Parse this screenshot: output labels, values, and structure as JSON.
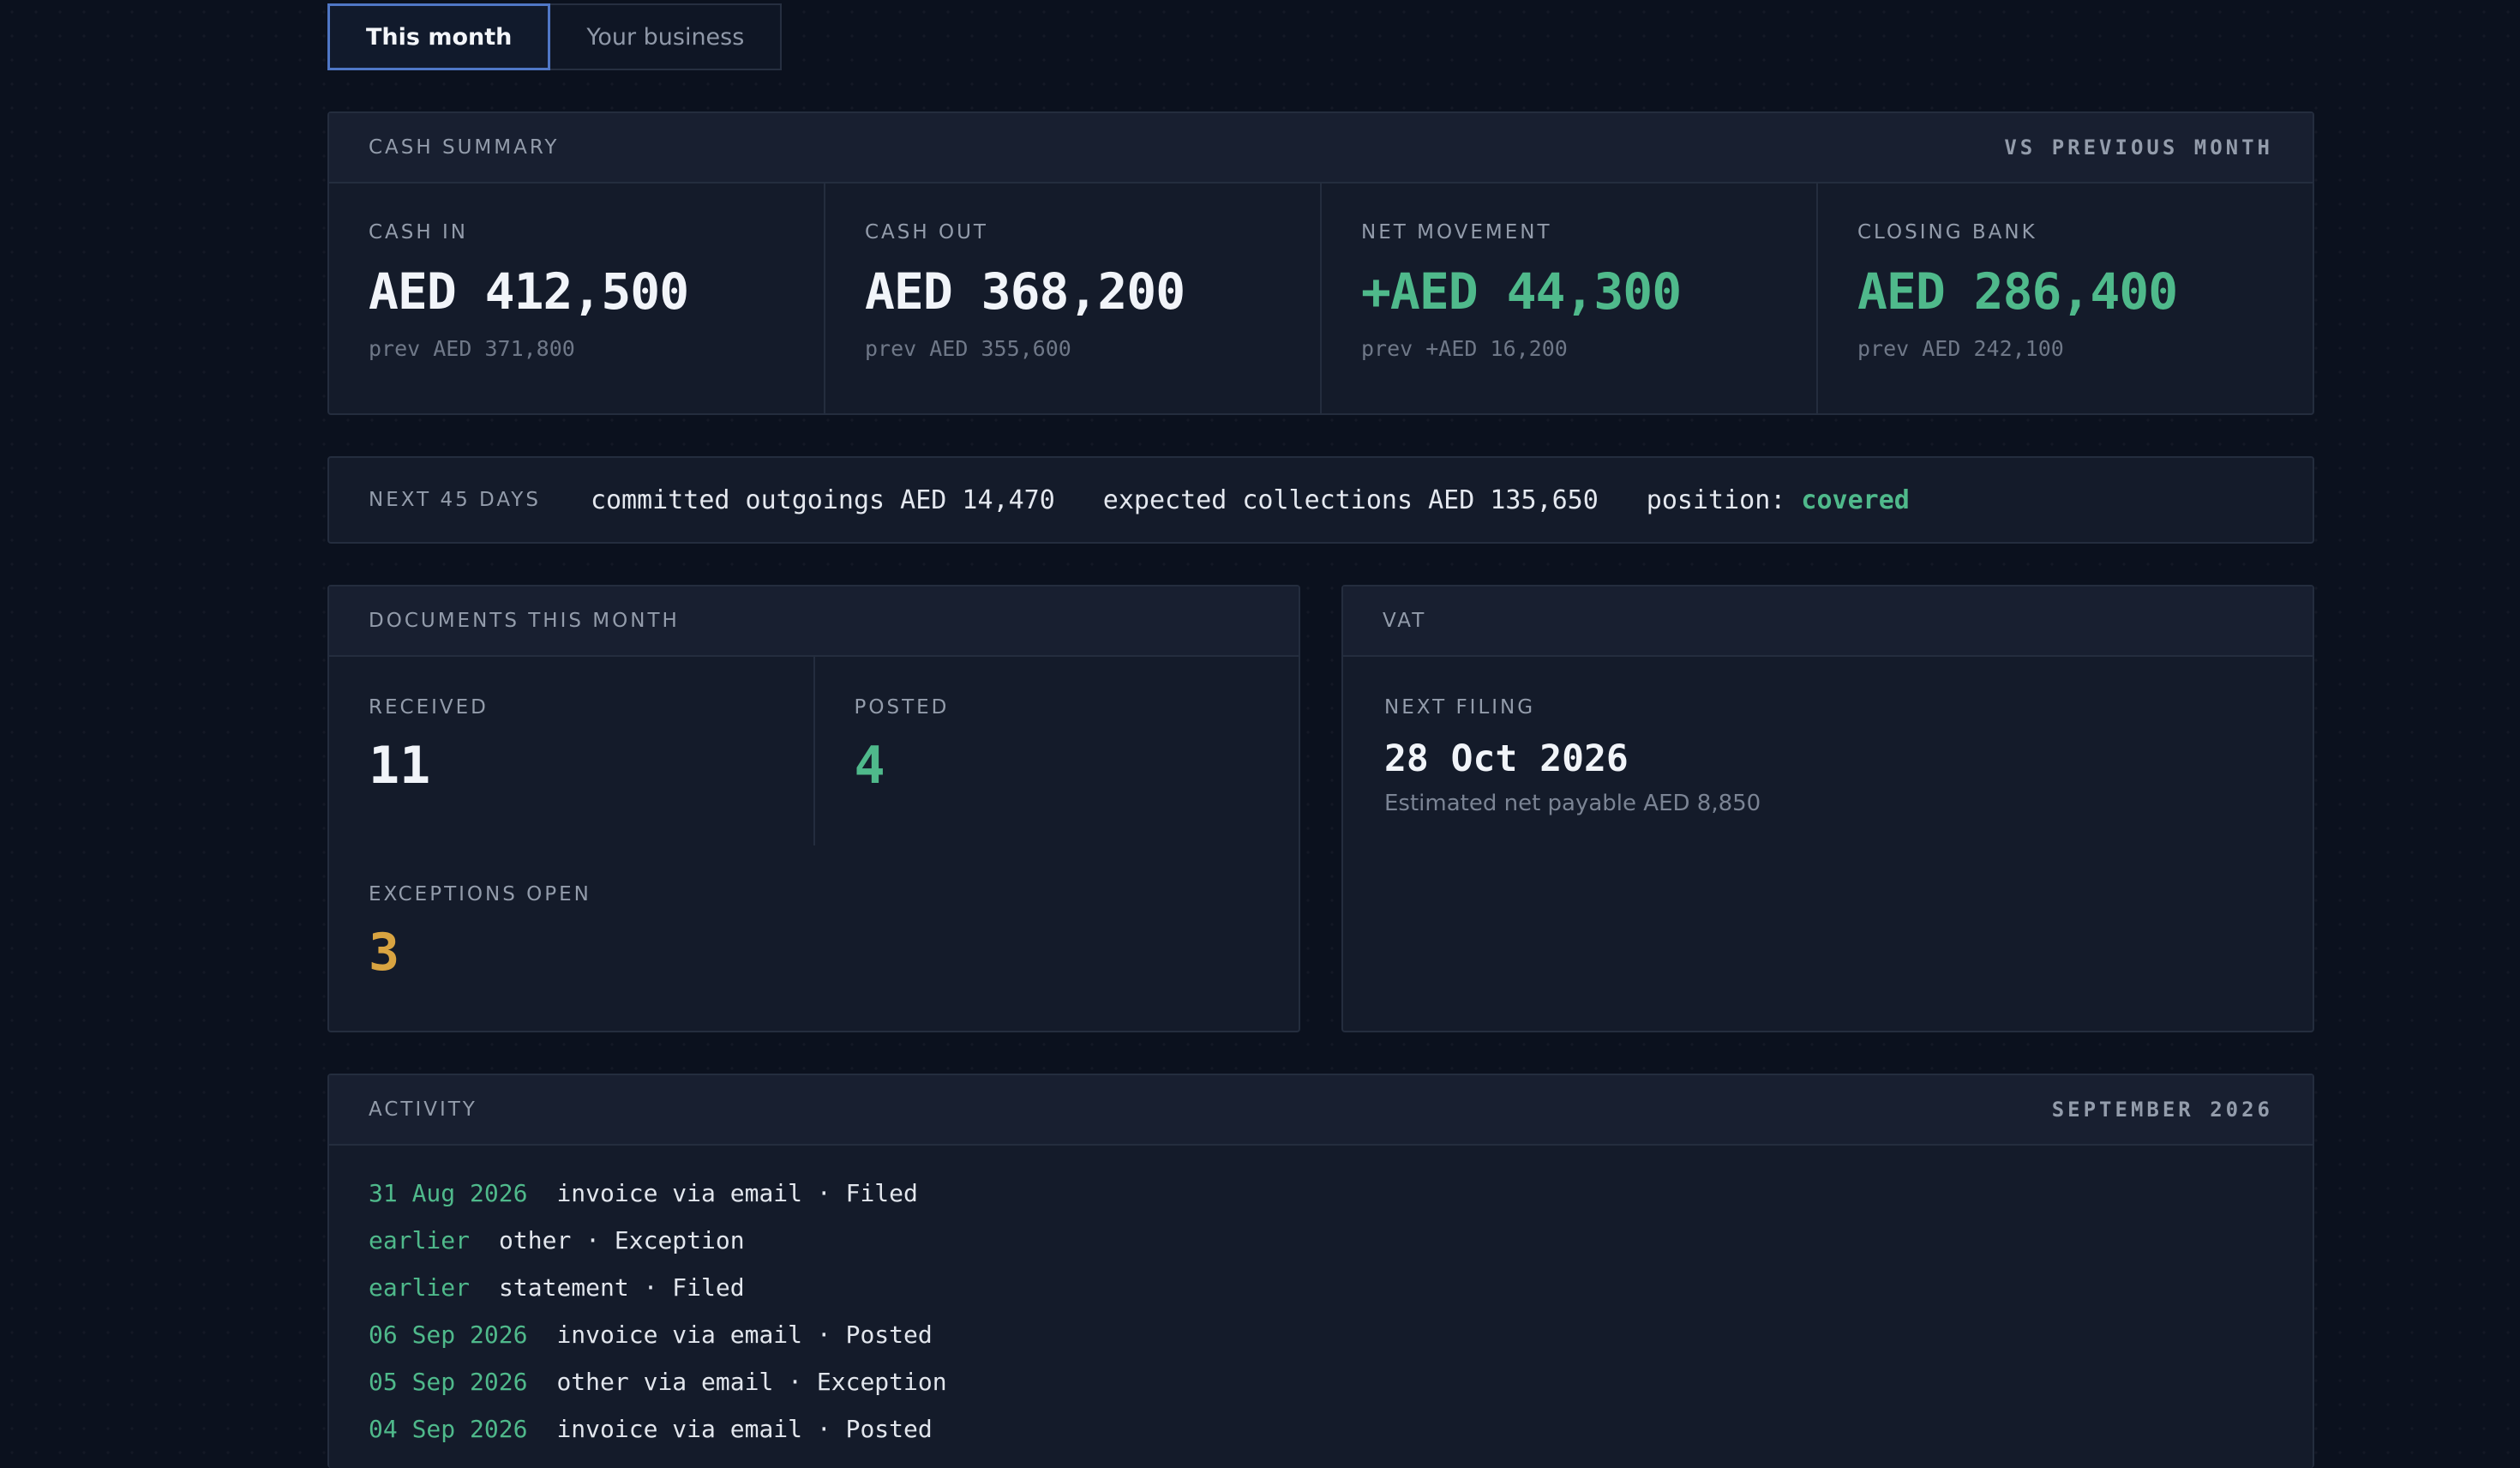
{
  "tabs": [
    {
      "label": "This month",
      "active": true
    },
    {
      "label": "Your business",
      "active": false
    }
  ],
  "cash_summary": {
    "title": "Cash summary",
    "compare": "vs previous month",
    "cells": [
      {
        "label": "Cash in",
        "value": "AED 412,500",
        "prev": "prev AED 371,800",
        "color": "#f1f4f9"
      },
      {
        "label": "Cash out",
        "value": "AED 368,200",
        "prev": "prev AED 355,600",
        "color": "#f1f4f9"
      },
      {
        "label": "Net movement",
        "value": "+AED 44,300",
        "prev": "prev +AED 16,200",
        "color": "#4fb98b"
      },
      {
        "label": "Closing bank",
        "value": "AED 286,400",
        "prev": "prev AED 242,100",
        "color": "#4fb98b"
      }
    ]
  },
  "next45": {
    "label": "Next 45 days",
    "committed": "committed outgoings AED 14,470",
    "expected": "expected collections AED 135,650",
    "position_label": "position:",
    "position_value": "covered"
  },
  "documents": {
    "title": "Documents this month",
    "received_label": "Received",
    "received": "11",
    "posted_label": "Posted",
    "posted": "4",
    "exceptions_label": "Exceptions open",
    "exceptions": "3"
  },
  "vat": {
    "title": "VAT",
    "next_filing_label": "Next filing",
    "next_filing_date": "28 Oct 2026",
    "estimate": "Estimated net payable AED 8,850"
  },
  "activity": {
    "title": "Activity",
    "period": "September 2026",
    "items": [
      {
        "date": "31 Aug 2026",
        "text": "invoice via email · Filed"
      },
      {
        "date": "earlier",
        "text": "other · Exception"
      },
      {
        "date": "earlier",
        "text": "statement · Filed"
      },
      {
        "date": "06 Sep 2026",
        "text": "invoice via email · Posted"
      },
      {
        "date": "05 Sep 2026",
        "text": "other via email · Exception"
      },
      {
        "date": "04 Sep 2026",
        "text": "invoice via email · Posted"
      }
    ]
  },
  "colors": {
    "accent_green": "#4fb98b",
    "accent_amber": "#d9a441",
    "tab_active_border": "#4f77c6"
  }
}
